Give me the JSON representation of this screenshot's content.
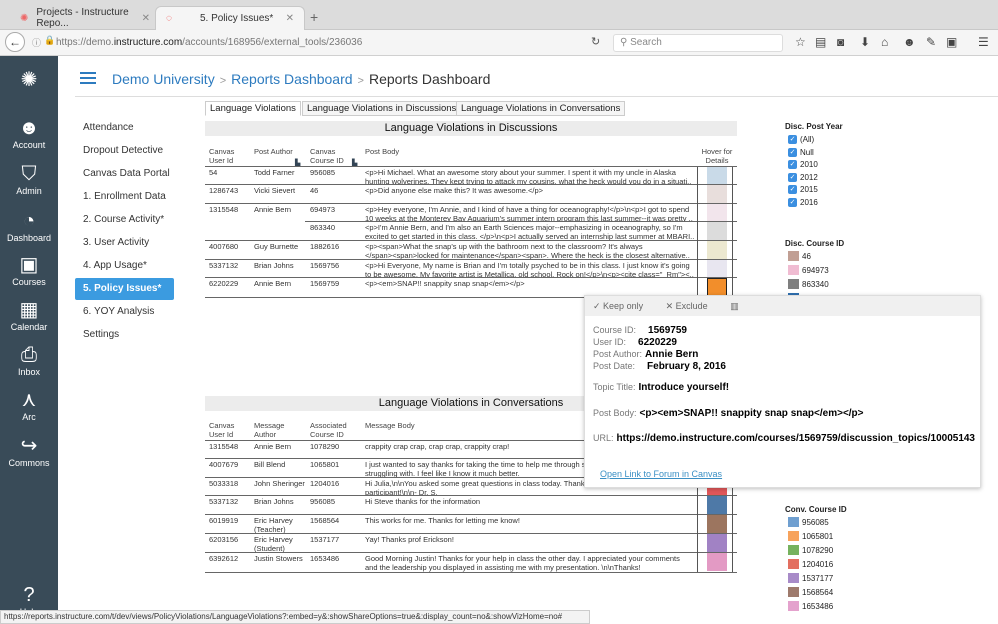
{
  "browser": {
    "tabs": [
      {
        "label": "Projects - Instructure Repo..."
      },
      {
        "label": "5. Policy Issues*"
      }
    ],
    "url_prefix": "https://demo.",
    "url_domain": "instructure.com",
    "url_path": "/accounts/168956/external_tools/236036",
    "search_placeholder": "Search",
    "status_url": "https://reports.instructure.com/t/dev/views/PolicyViolations/LanguageViolations?:embed=y&:showShareOptions=true&:display_count=no&:showVizHome=no#"
  },
  "global_nav": [
    {
      "label": "Account",
      "icon": "panda-avatar-icon"
    },
    {
      "label": "Admin",
      "icon": "shield-star-icon"
    },
    {
      "label": "Dashboard",
      "icon": "gauge-icon"
    },
    {
      "label": "Courses",
      "icon": "notebook-icon"
    },
    {
      "label": "Calendar",
      "icon": "calendar-icon"
    },
    {
      "label": "Inbox",
      "icon": "inbox-icon"
    },
    {
      "label": "Arc",
      "icon": "arc-icon"
    },
    {
      "label": "Commons",
      "icon": "commons-icon"
    },
    {
      "label": "Help",
      "icon": "help-icon"
    }
  ],
  "breadcrumb": [
    "Demo University",
    "Reports Dashboard",
    "Reports Dashboard"
  ],
  "left_nav": [
    "Attendance",
    "Dropout Detective",
    "Canvas Data Portal",
    "1. Enrollment Data",
    "2. Course Activity*",
    "3. User Activity",
    "4. App Usage*",
    "5. Policy Issues*",
    "6. YOY Analysis",
    "Settings"
  ],
  "left_nav_active": 7,
  "view_tabs": [
    "Language Violations",
    "Language Violations in Discussions",
    "Language Violations in Conversations"
  ],
  "discussions": {
    "title": "Language Violations in Discussions",
    "headers": [
      "Canvas\nUser Id",
      "Post Author",
      "Canvas\nCourse ID",
      "Post Body",
      "Hover for\nDetails"
    ],
    "rows": [
      {
        "user": "54",
        "author": "Todd Farner",
        "course": "956085",
        "body": "<p>Hi Michael. What an awesome story about your summer. I spent it with my uncle in Alaska\nhunting wolverines. They kept trying to attack my cousins, what the heck would you do in a situati..",
        "color": "#c9dae8"
      },
      {
        "user": "1286743",
        "author": "Vicki Sievert",
        "course": "46",
        "body": "<p>Did anyone else make this? It was awesome.</p>",
        "color": "#e8dedc"
      },
      {
        "user": "1315548",
        "author": "Annie Bern",
        "course": "694973",
        "body": "<p>Hey everyone, I'm Annie, and I kind of have a thing for oceanography!</p>\\n<p>I got to spend\n10 weeks at the Monterey Bay Aquarium's summer intern program this last summer--it was pretty ..",
        "color": "#f2e5ec"
      },
      {
        "user": "",
        "author": "",
        "course": "863340",
        "body": "<p>I'm Annie Bern, and I'm also an Earth Sciences major--emphasizing in oceanography, so I'm\nexcited to get started in this class. </p>\\n<p>I actually served an internship last summer at MBARI..",
        "color": "#dcdcdc"
      },
      {
        "user": "4007680",
        "author": "Guy Burnette",
        "course": "1882616",
        "body": "<p><span>What the snap's up with the bathroom next to the classroom?  It's always\n</span><span>locked for maintenance</span><span>.  Where the heck is the closest alternative..",
        "color": "#ece8d0"
      },
      {
        "user": "5337132",
        "author": "Brian Johns",
        "course": "1569756",
        "body": "<p>Hi Everyone, My name is Brian and I'm totally psyched to be in this class. I just know it's going\nto be awesome. My favorite artist is Metallica, old school. Rock on!</p>\\n<p><cite class=\"_Rm\"><..",
        "color": "#e8e6f0"
      },
      {
        "user": "6220229",
        "author": "Annie Bern",
        "course": "1569759",
        "body": "<p><em>SNAP!! snappity snap snap</em></p>",
        "color": "#f28e2b"
      }
    ]
  },
  "conversations": {
    "title": "Language Violations in Conversations",
    "headers": [
      "Canvas\nUser Id",
      "Message\nAuthor",
      "Associated\nCourse ID",
      "Message Body"
    ],
    "rows": [
      {
        "user": "1315548",
        "author": "Annie Bern",
        "course": "1078290",
        "body": "crappity crap crap, crap crap, crappity crap!",
        "color": "#59a14f"
      },
      {
        "user": "4007679",
        "author": "Bill Blend",
        "course": "1065801",
        "body": "I just wanted to say thanks for taking the time to help me through s\nstruggling with.  I feel like I know it much better.",
        "color": "#f28e2b"
      },
      {
        "user": "5033318",
        "author": "John Sheringer",
        "course": "1204016",
        "body": "Hi Julia,\\n\\nYou asked some great questions in class today.  Thank\nparticipant!\\n\\n- Dr. S.",
        "color": "#e15759"
      },
      {
        "user": "5337132",
        "author": "Brian Johns",
        "course": "956085",
        "body": "Hi Steve thanks for the information",
        "color": "#4e79a7"
      },
      {
        "user": "6019919",
        "author": "Eric Harvey\n(Teacher)",
        "course": "1568564",
        "body": "This works for me. Thanks for letting me know!",
        "color": "#9c755f"
      },
      {
        "user": "6203156",
        "author": "Eric Harvey\n(Student)",
        "course": "1537177",
        "body": "Yay! Thanks prof Erickson!",
        "color": "#a182c4"
      },
      {
        "user": "6392612",
        "author": "Justin Stowers",
        "course": "1653486",
        "body": "Good Morning Justin! Thanks for your help in class the other day. I appreciated your comments\nand the leadership you displayed in assisting me with my presentation. \\n\\nThanks!",
        "color": "#e39ac4"
      }
    ]
  },
  "tooltip": {
    "actions": [
      "Keep only",
      "Exclude"
    ],
    "fields": [
      {
        "label": "Course ID:",
        "value": "1569759"
      },
      {
        "label": "User ID:",
        "value": "6220229"
      },
      {
        "label": "Post Author:",
        "value": "Annie Bern"
      },
      {
        "label": "Post Date:",
        "value": "February 8, 2016"
      },
      {
        "label": "Topic Title:",
        "value": "Introduce yourself!"
      },
      {
        "label": "Post Body:",
        "value": "<p><em>SNAP!! snappity snap snap</em></p>"
      },
      {
        "label": "URL:",
        "value": "https://demo.instructure.com/courses/1569759/discussion_topics/10005143"
      }
    ],
    "link": "Open Link to Forum in Canvas"
  },
  "filters": {
    "post_year": {
      "title": "Disc. Post Year",
      "items": [
        "(All)",
        "Null",
        "2010",
        "2012",
        "2015",
        "2016"
      ]
    },
    "disc_course": {
      "title": "Disc. Course ID",
      "items": [
        {
          "label": "46",
          "color": "#c19f94"
        },
        {
          "label": "694973",
          "color": "#f0bcd2"
        },
        {
          "label": "863340",
          "color": "#7f7f7f"
        }
      ]
    },
    "conv_course": {
      "title": "Conv. Course ID",
      "items": [
        {
          "label": "956085",
          "color": "#6f9fd0"
        },
        {
          "label": "1065801",
          "color": "#f7a35c"
        },
        {
          "label": "1078290",
          "color": "#76b25e"
        },
        {
          "label": "1204016",
          "color": "#e36f60"
        },
        {
          "label": "1537177",
          "color": "#a88bc8"
        },
        {
          "label": "1568564",
          "color": "#9e7a6c"
        },
        {
          "label": "1653486",
          "color": "#e4a2cd"
        }
      ]
    }
  }
}
